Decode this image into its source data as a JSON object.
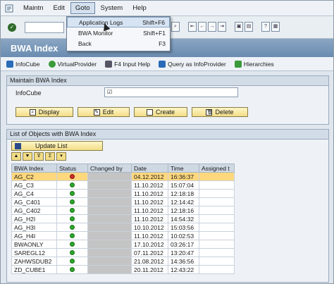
{
  "menubar": {
    "items": [
      "Maintn",
      "Edit",
      "Goto",
      "System",
      "Help"
    ]
  },
  "dropdown": {
    "items": [
      {
        "label": "Application Logs",
        "shortcut": "Shift+F6"
      },
      {
        "label": "BWA Monitor",
        "shortcut": "Shift+F1"
      },
      {
        "label": "Back",
        "shortcut": "F3"
      }
    ]
  },
  "title": "BWA Index",
  "appbar": {
    "items": [
      "InfoCube",
      "VirtualProvider",
      "F4 Input Help",
      "Query as InfoProvider",
      "Hierarchies"
    ]
  },
  "maintain": {
    "title": "Maintain BWA Index",
    "field_label": "InfoCube",
    "buttons": [
      "Display",
      "Edit",
      "Create",
      "Delete"
    ]
  },
  "list": {
    "title": "List of Objects with BWA Index",
    "update_label": "Update List",
    "columns": [
      "BWA Index",
      "Status",
      "Changed by",
      "Date",
      "Time",
      "Assigned t"
    ],
    "rows": [
      {
        "name": "AG_C2",
        "status": "red",
        "date": "04.12.2012",
        "time": "16:36:37"
      },
      {
        "name": "AG_C3",
        "status": "green",
        "date": "11.10.2012",
        "time": "15:07:04"
      },
      {
        "name": "AG_C4",
        "status": "green",
        "date": "11.10.2012",
        "time": "12:18:18"
      },
      {
        "name": "AG_C401",
        "status": "green",
        "date": "11.10.2012",
        "time": "12:14:42"
      },
      {
        "name": "AG_C402",
        "status": "green",
        "date": "11.10.2012",
        "time": "12:18:16"
      },
      {
        "name": "AG_H2I",
        "status": "green",
        "date": "11.10.2012",
        "time": "14:54:32"
      },
      {
        "name": "AG_H3I",
        "status": "green",
        "date": "10.10.2012",
        "time": "15:03:56"
      },
      {
        "name": "AG_H4I",
        "status": "green",
        "date": "11.10.2012",
        "time": "10:02:53"
      },
      {
        "name": "BWAONLY",
        "status": "green",
        "date": "17.10.2012",
        "time": "03:26:17"
      },
      {
        "name": "SAREGL12",
        "status": "green",
        "date": "07.11.2012",
        "time": "13:20:47"
      },
      {
        "name": "ZAHWSDUB2",
        "status": "green",
        "date": "21.08.2012",
        "time": "14:36:56"
      },
      {
        "name": "ZD_CUBE1",
        "status": "green",
        "date": "20.11.2012",
        "time": "12:43:22"
      }
    ]
  },
  "colors": {
    "title_bar": "#7596ba",
    "button": "#f2dd86",
    "selected_row": "#ffd87e"
  }
}
